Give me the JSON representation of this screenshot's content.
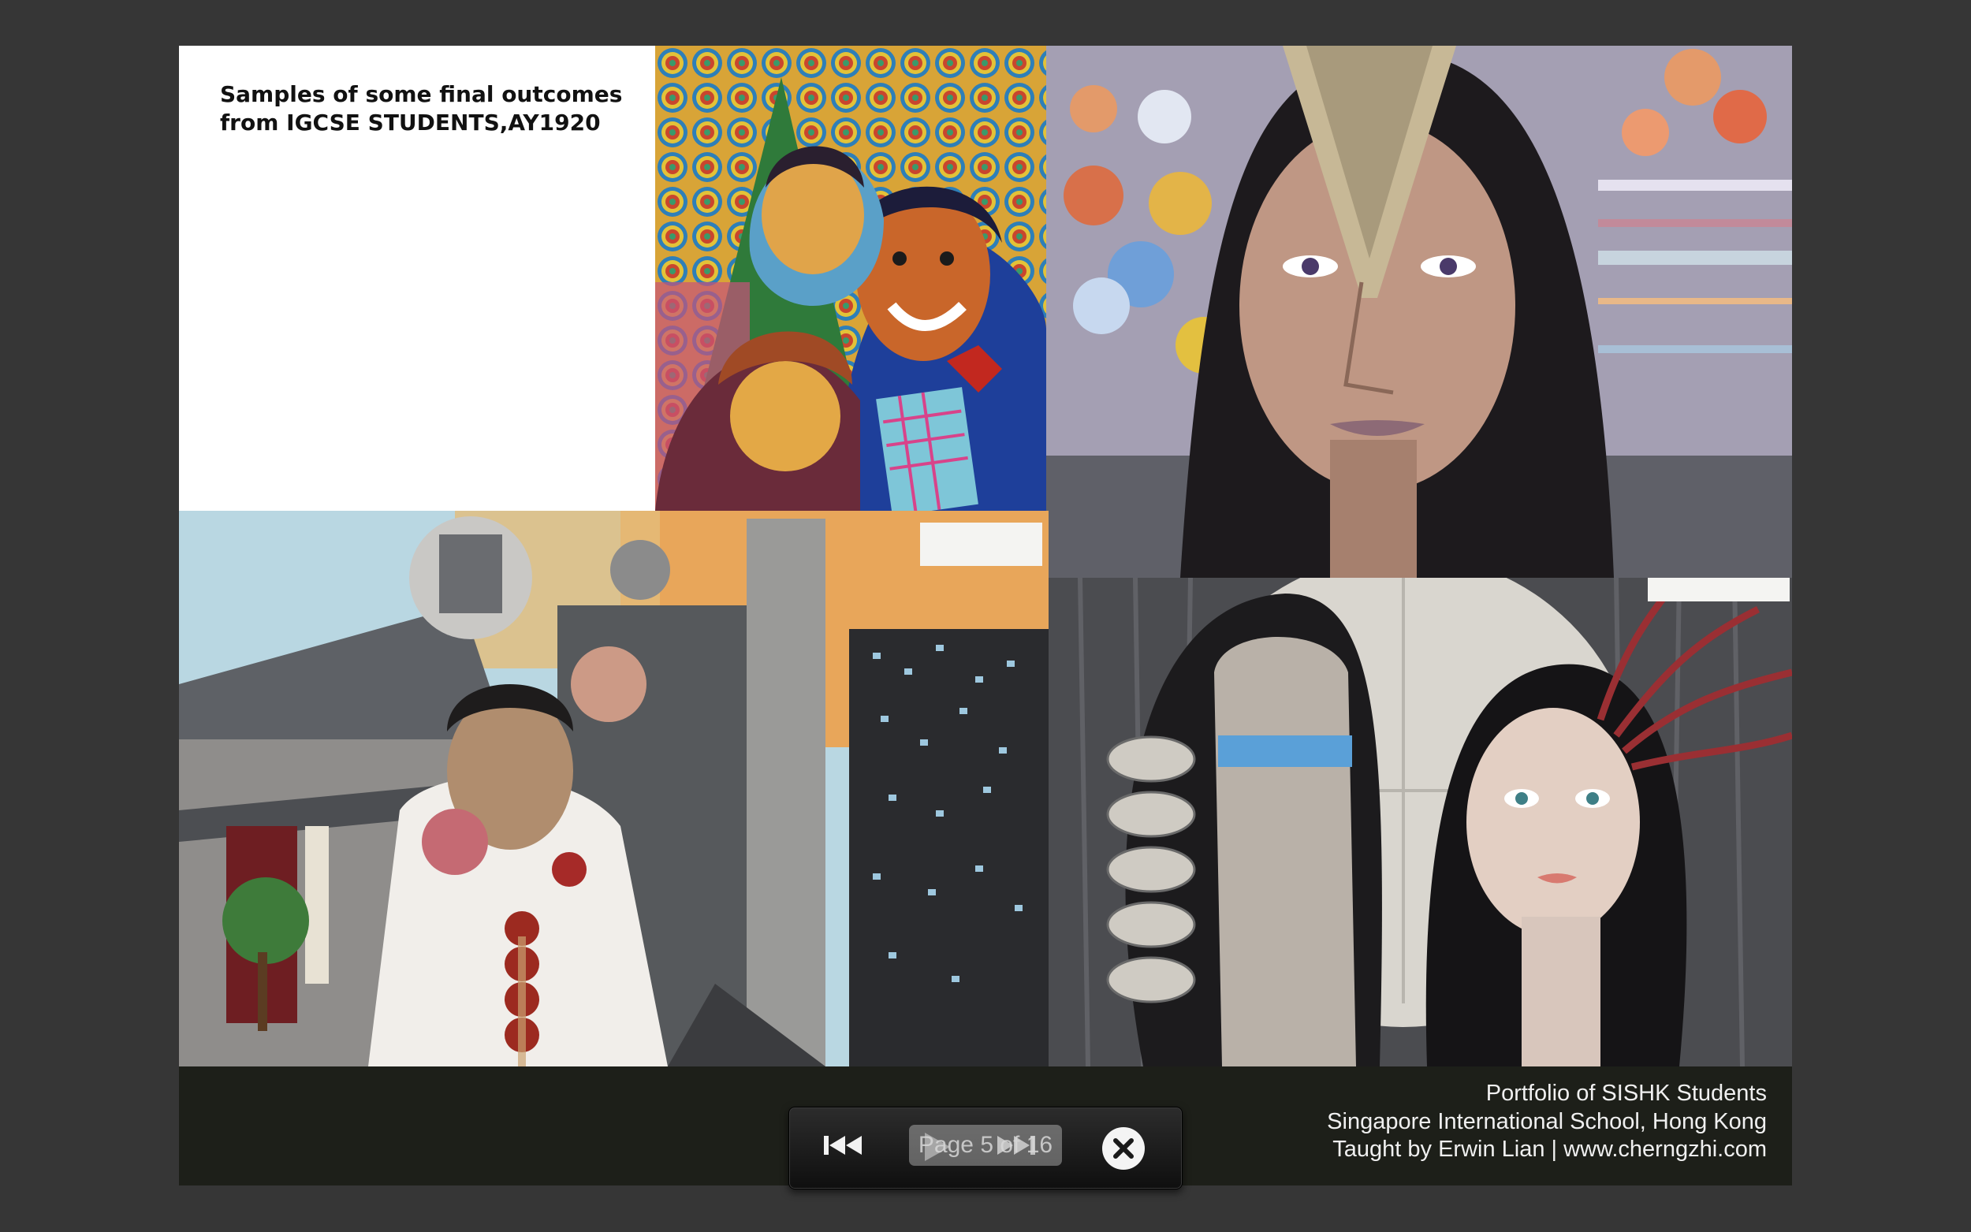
{
  "page": {
    "title_lines": [
      "Samples of some final outcomes",
      "from IGCSE STUDENTS,AY1920"
    ],
    "credits": [
      "Portfolio of SISHK Students",
      "Singapore International School, Hong Kong",
      "Taught by Erwin Lian | www.cherngzhi.com"
    ]
  },
  "viewer": {
    "page_indicator": "Page 5 of 16",
    "buttons": [
      "first-page",
      "play",
      "next-page",
      "close"
    ]
  },
  "icons": {
    "first": "skip-to-start-icon",
    "play": "play-icon",
    "next": "skip-forward-icon",
    "close": "close-circle-icon"
  },
  "colors": {
    "background": "#363636",
    "page_footer": "#1d1f19",
    "title_panel": "#ffffff"
  }
}
